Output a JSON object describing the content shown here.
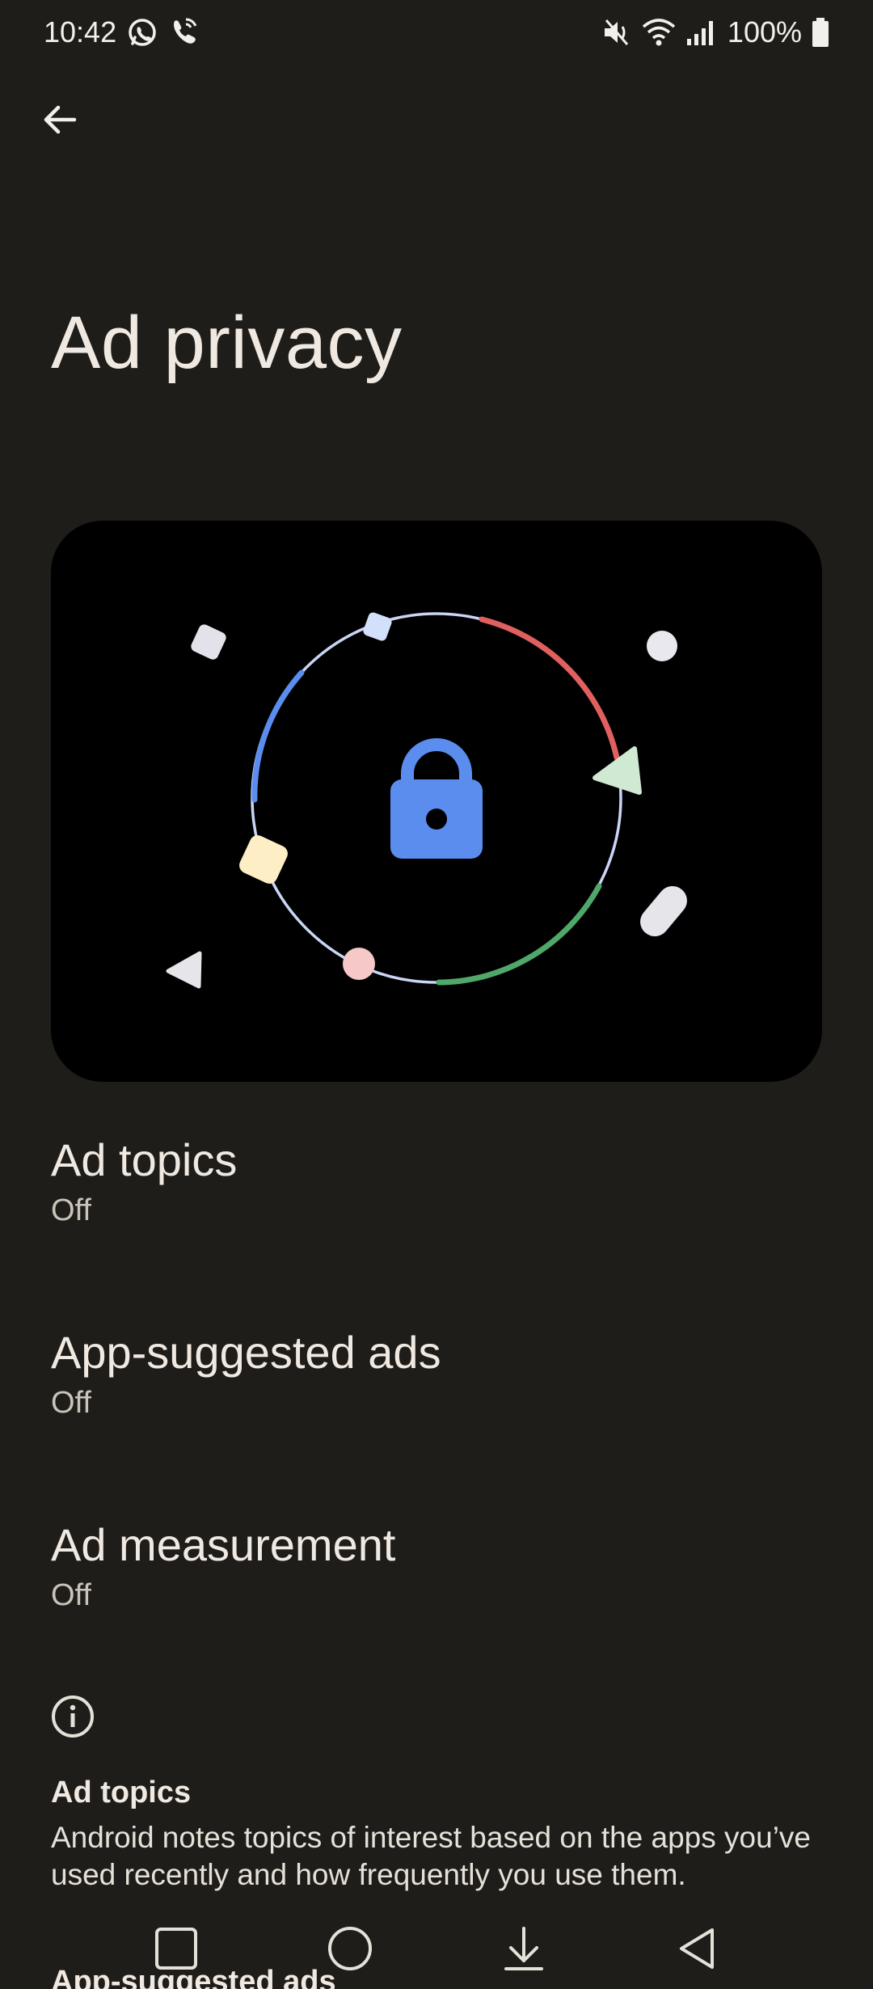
{
  "status_bar": {
    "time": "10:42",
    "battery": "100%",
    "icons": [
      "whatsapp-icon",
      "wifi-call-icon",
      "mute-icon",
      "wifi-icon",
      "signal-icon",
      "battery-icon"
    ]
  },
  "header": {
    "back_icon": "arrow-back-icon",
    "title": "Ad privacy"
  },
  "settings": [
    {
      "title": "Ad topics",
      "value": "Off"
    },
    {
      "title": "App-suggested ads",
      "value": "Off"
    },
    {
      "title": "Ad measurement",
      "value": "Off"
    }
  ],
  "footer": {
    "info_icon": "info-icon",
    "heading": "Ad topics",
    "text": "Android notes topics of interest based on the apps you’ve used recently and how frequently you use them.",
    "next_heading": "App-suggested ads"
  },
  "nav_bar": {
    "icons": [
      "recents-square-icon",
      "home-circle-icon",
      "keyboard-hide-icon",
      "back-triangle-icon"
    ]
  },
  "colors": {
    "background": "#1f1d1a",
    "card": "#000000",
    "lock_blue": "#5b8def",
    "arc_red": "#e06060",
    "arc_green": "#4fa86a",
    "arc_blue": "#5b8def"
  }
}
